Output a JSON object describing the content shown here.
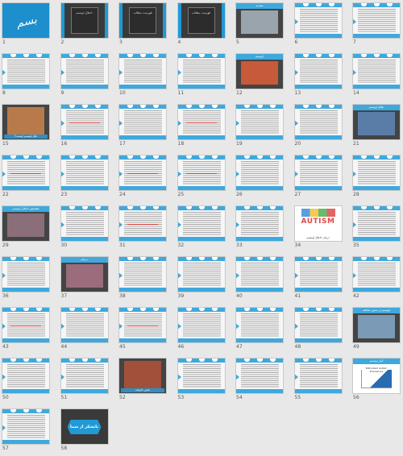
{
  "slides": [
    {
      "n": "1",
      "kind": "title",
      "text": "بسم الله"
    },
    {
      "n": "2",
      "kind": "dark",
      "text": "اختلال اوتیسم"
    },
    {
      "n": "3",
      "kind": "dark",
      "text": "فهرست مطالب"
    },
    {
      "n": "4",
      "kind": "dark",
      "text": "فهرست مطالب"
    },
    {
      "n": "5",
      "kind": "img",
      "title": "مقدمه",
      "pic": "#9aa4ad"
    },
    {
      "n": "6",
      "kind": "text"
    },
    {
      "n": "7",
      "kind": "text"
    },
    {
      "n": "8",
      "kind": "text"
    },
    {
      "n": "9",
      "kind": "text"
    },
    {
      "n": "10",
      "kind": "text"
    },
    {
      "n": "11",
      "kind": "text"
    },
    {
      "n": "12",
      "kind": "img",
      "title": "اوتیسم",
      "pic": "#c65a3a"
    },
    {
      "n": "13",
      "kind": "text"
    },
    {
      "n": "14",
      "kind": "text"
    },
    {
      "n": "15",
      "kind": "img",
      "title": "",
      "pic": "#b97a4b",
      "caption": "علل اوتیسم چیست؟"
    },
    {
      "n": "16",
      "kind": "text",
      "red": true
    },
    {
      "n": "17",
      "kind": "text"
    },
    {
      "n": "18",
      "kind": "text",
      "red": true
    },
    {
      "n": "19",
      "kind": "text"
    },
    {
      "n": "20",
      "kind": "text"
    },
    {
      "n": "21",
      "kind": "img",
      "title": "علائم اوتیسم",
      "pic": "#5a7da8"
    },
    {
      "n": "22",
      "kind": "text",
      "red": true
    },
    {
      "n": "23",
      "kind": "text"
    },
    {
      "n": "24",
      "kind": "text",
      "red": true
    },
    {
      "n": "25",
      "kind": "text",
      "red": true
    },
    {
      "n": "26",
      "kind": "text"
    },
    {
      "n": "27",
      "kind": "text"
    },
    {
      "n": "28",
      "kind": "text"
    },
    {
      "n": "29",
      "kind": "img",
      "title": "تشخیص اختلال اوتیسم",
      "pic": "#8a6f7a"
    },
    {
      "n": "30",
      "kind": "text"
    },
    {
      "n": "31",
      "kind": "text",
      "red": true
    },
    {
      "n": "32",
      "kind": "text"
    },
    {
      "n": "33",
      "kind": "text"
    },
    {
      "n": "34",
      "kind": "autism",
      "word": "AUTISM",
      "caption": "درمان اختلال اوتیسم"
    },
    {
      "n": "35",
      "kind": "text"
    },
    {
      "n": "36",
      "kind": "text"
    },
    {
      "n": "37",
      "kind": "img",
      "title": "درمان",
      "pic": "#9b6c7c"
    },
    {
      "n": "38",
      "kind": "text"
    },
    {
      "n": "39",
      "kind": "text"
    },
    {
      "n": "40",
      "kind": "text"
    },
    {
      "n": "41",
      "kind": "text"
    },
    {
      "n": "42",
      "kind": "text"
    },
    {
      "n": "43",
      "kind": "text",
      "red": true
    },
    {
      "n": "44",
      "kind": "text"
    },
    {
      "n": "45",
      "kind": "text",
      "red": true
    },
    {
      "n": "46",
      "kind": "text"
    },
    {
      "n": "47",
      "kind": "text"
    },
    {
      "n": "48",
      "kind": "text"
    },
    {
      "n": "49",
      "kind": "img",
      "title": "اوتیسم در سنین مختلف",
      "pic": "#7a9ab5"
    },
    {
      "n": "50",
      "kind": "text"
    },
    {
      "n": "51",
      "kind": "text"
    },
    {
      "n": "52",
      "kind": "img",
      "title": "",
      "pic": "#a3503a",
      "caption": "نقش خانواده"
    },
    {
      "n": "53",
      "kind": "text"
    },
    {
      "n": "54",
      "kind": "text"
    },
    {
      "n": "55",
      "kind": "text"
    },
    {
      "n": "56",
      "kind": "chart",
      "title": "آمار اوتیسم",
      "ctitle": "Estimated Autism Prevalence"
    },
    {
      "n": "57",
      "kind": "text"
    },
    {
      "n": "58",
      "kind": "end",
      "text": "باتشکر از شما"
    }
  ]
}
